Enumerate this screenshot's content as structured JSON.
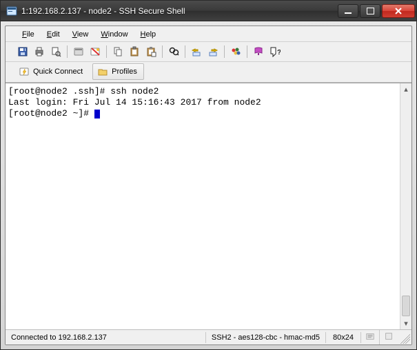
{
  "title": "1:192.168.2.137 - node2 - SSH Secure Shell",
  "menu": {
    "file": "File",
    "edit": "Edit",
    "view": "View",
    "window": "Window",
    "help": "Help"
  },
  "connectbar": {
    "quick_connect": "Quick Connect",
    "profiles": "Profiles"
  },
  "terminal": {
    "line1": "[root@node2 .ssh]# ssh node2",
    "line2": "Last login: Fri Jul 14 15:16:43 2017 from node2",
    "line3": "[root@node2 ~]# "
  },
  "status": {
    "connection": "Connected to 192.168.2.137",
    "cipher": "SSH2 - aes128-cbc - hmac-md5",
    "size": "80x24"
  },
  "icons": {
    "app": "terminal-icon",
    "save": "save-icon",
    "print": "print-icon",
    "print_preview": "print-preview-icon",
    "new": "new-terminal-icon",
    "disconnect": "disconnect-icon",
    "copy": "copy-icon",
    "paste": "paste-icon",
    "clipboard": "clipboard-icon",
    "find": "find-icon",
    "transfer": "transfer-icon",
    "transfer2": "transfer-queue-icon",
    "colors": "colors-icon",
    "help": "help-icon",
    "whatsthis": "whats-this-icon",
    "lightning": "quick-connect-icon",
    "folder": "folder-icon"
  }
}
